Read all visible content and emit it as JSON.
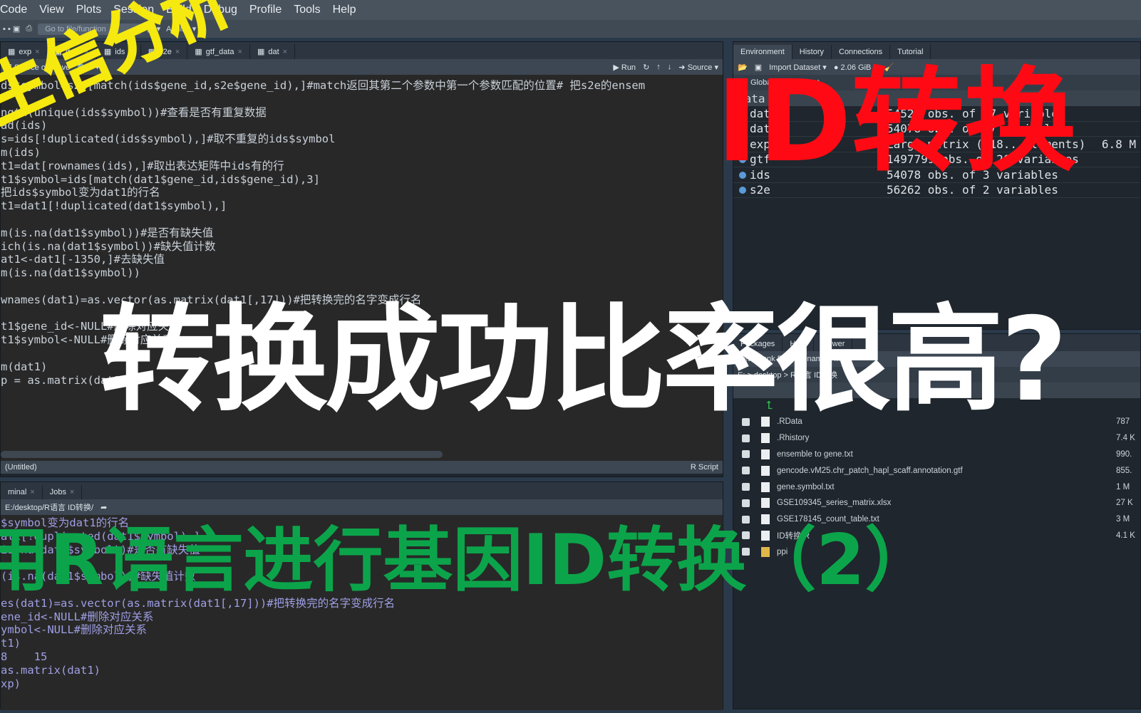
{
  "menu": [
    "Code",
    "View",
    "Plots",
    "Session",
    "Build",
    "Debug",
    "Profile",
    "Tools",
    "Help"
  ],
  "toolbar": {
    "goto": "Go to file/function",
    "addins": "Addins"
  },
  "editor": {
    "tabs": [
      "exp",
      "dat1",
      "ids",
      "s2e",
      "gtf_data",
      "dat"
    ],
    "source_on_save": "Source on Save",
    "run": "Run",
    "source": "Source",
    "lines": [
      "ds$symbol=s2e[match(ids$gene_id,s2e$gene_id),]#match返回其第二个参数中第一个参数匹配的位置# 把s2e的ensem",
      "",
      "ngth(unique(ids$symbol))#查看是否有重复数据",
      "ad(ids)",
      "s=ids[!duplicated(ids$symbol),]#取不重复的ids$symbol",
      "m(ids)",
      "t1=dat[rownames(ids),]#取出表达矩阵中ids有的行",
      "t1$symbol=ids[match(dat1$gene_id,ids$gene_id),3]",
      "把ids$symbol变为dat1的行名",
      "t1=dat1[!duplicated(dat1$symbol),]",
      "",
      "m(is.na(dat1$symbol))#是否有缺失值",
      "ich(is.na(dat1$symbol))#缺失值计数",
      "at1<-dat1[-1350,]#去缺失值",
      "m(is.na(dat1$symbol))",
      "",
      "wnames(dat1)=as.vector(as.matrix(dat1[,17]))#把转换完的名字变成行名",
      "",
      "t1$gene_id<-NULL#删除对应关系",
      "t1$symbol<-NULL#删除对应关系",
      "",
      "m(dat1)",
      "p = as.matrix(dat1)"
    ],
    "status_left": "(Untitled)",
    "status_right": "R Script"
  },
  "console": {
    "tabs": [
      "minal",
      "Jobs"
    ],
    "path": "E:/desktop/R语言 ID转换/",
    "lines": [
      "$symbol变为dat1的行名",
      "at1[!duplicated(dat1$symbol),]",
      "is.na(dat1$symbol))#是否有缺失值",
      "",
      "(is.na(dat1$symbol))#缺失值计数",
      "",
      "es(dat1)=as.vector(as.matrix(dat1[,17]))#把转换完的名字变成行名",
      "ene_id<-NULL#删除对应关系",
      "ymbol<-NULL#删除对应关系",
      "t1)",
      "8    15",
      "as.matrix(dat1)",
      "xp)"
    ]
  },
  "env": {
    "tabs": [
      "Environment",
      "History",
      "Connections",
      "Tutorial"
    ],
    "import": "Import Dataset",
    "memory": "2.06 GiB",
    "lang": "R",
    "scope": "Global Environment",
    "section": "Data",
    "rows": [
      {
        "n": "dat",
        "v": "54527 obs. of 17 variables",
        "s": ""
      },
      {
        "n": "dat1",
        "v": "54078 obs. of 17 variables",
        "s": ""
      },
      {
        "n": "exp",
        "v": "Large matrix (918.. elements)",
        "s": "6.8 M"
      },
      {
        "n": "gtf",
        "v": "1497799 obs. of 26 variables",
        "s": ""
      },
      {
        "n": "ids",
        "v": "54078 obs. of 3 variables",
        "s": ""
      },
      {
        "n": "s2e",
        "v": "56262 obs. of 2 variables",
        "s": ""
      }
    ]
  },
  "files": {
    "tabs": [
      "Packages",
      "Help",
      "Viewer"
    ],
    "tools": [
      "New Blank File",
      "Rename",
      "More"
    ],
    "path": "E: > desktop > R语言 ID转换",
    "rows": [
      {
        "n": ".RData",
        "s": "787"
      },
      {
        "n": ".Rhistory",
        "s": "7.4 K"
      },
      {
        "n": "ensemble to gene.txt",
        "s": "990."
      },
      {
        "n": "gencode.vM25.chr_patch_hapl_scaff.annotation.gtf",
        "s": "855."
      },
      {
        "n": "gene.symbol.txt",
        "s": "1 M"
      },
      {
        "n": "GSE109345_series_matrix.xlsx",
        "s": "27 K"
      },
      {
        "n": "GSE178145_count_table.txt",
        "s": "3 M"
      },
      {
        "n": "ID转换.R",
        "s": "4.1 K"
      },
      {
        "n": "ppi",
        "s": ""
      }
    ]
  },
  "overlay": {
    "yellow": "生信分析",
    "red": "ID转换",
    "white": "转换成功比率很高?",
    "green": "用R语言进行基因ID转换（2）"
  },
  "colors": {
    "yellow": "#f5e90f",
    "red": "#ff0a14",
    "white": "#ffffff",
    "green": "#0ca44a"
  }
}
